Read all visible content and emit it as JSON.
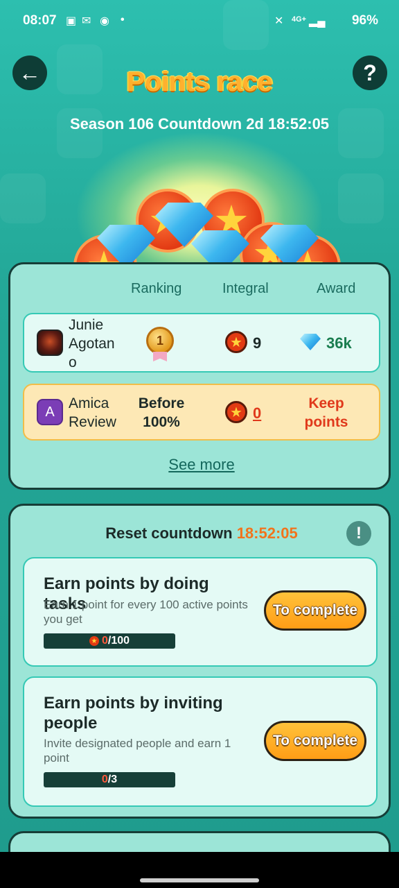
{
  "status_bar": {
    "time": "08:07",
    "battery": "96%",
    "network": "4G+"
  },
  "header": {
    "back_icon": "arrow-left-icon",
    "help_label": "?",
    "title": "Points race",
    "subtitle": "Season 106 Countdown 2d 18:52:05"
  },
  "ranking": {
    "columns": [
      "Ranking",
      "Integral",
      "Award"
    ],
    "rows": [
      {
        "name_lines": [
          "Junie",
          "Agotan",
          "o"
        ],
        "rank": "1",
        "integral": "9",
        "award": "36k"
      },
      {
        "avatar_letter": "A",
        "name_lines": [
          "Amica",
          "Review"
        ],
        "rank_lines": [
          "Before",
          "100%"
        ],
        "integral": "0",
        "award_lines": [
          "Keep",
          "points"
        ]
      }
    ],
    "see_more": "See more"
  },
  "tasks": {
    "reset_label": "Reset countdown",
    "reset_time": "18:52:05",
    "info_label": "!",
    "items": [
      {
        "title": "Earn points by doing tasks",
        "desc": "Earn 1 point for every 100 active points you get",
        "progress_current": "0",
        "progress_total": "/100",
        "button": "To complete"
      },
      {
        "title": "Earn points by inviting people",
        "desc": "Invite designated people and earn 1 point",
        "progress_current": "0",
        "progress_total": "/3",
        "button": "To complete"
      }
    ]
  },
  "colors": {
    "background": "#2eb8a8",
    "panel": "#9ce5d7",
    "title": "#ffb02e",
    "accent_orange": "#f2731b",
    "keep_points": "#e0391b",
    "award_green": "#1a7d4f"
  }
}
